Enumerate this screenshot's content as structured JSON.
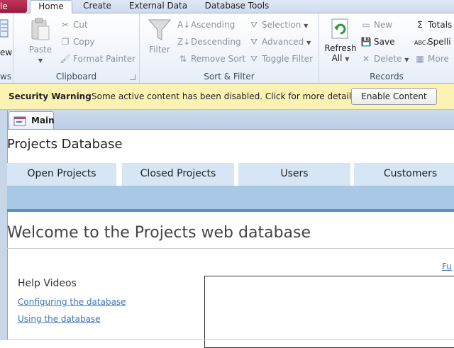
{
  "ribbon": {
    "file_tab": "le",
    "tabs": [
      "Home",
      "Create",
      "External Data",
      "Database Tools"
    ],
    "left_cut": {
      "view_label": "ew",
      "views_group": "ws"
    },
    "clipboard": {
      "label": "Clipboard",
      "paste": "Paste",
      "cut": "Cut",
      "copy": "Copy",
      "format_painter": "Format Painter"
    },
    "sort_filter": {
      "label": "Sort & Filter",
      "filter": "Filter",
      "ascending": "Ascending",
      "descending": "Descending",
      "remove_sort": "Remove Sort",
      "selection": "Selection",
      "advanced": "Advanced",
      "toggle_filter": "Toggle Filter"
    },
    "records": {
      "label": "Records",
      "refresh_all_line1": "Refresh",
      "refresh_all_line2": "All",
      "new": "New",
      "save": "Save",
      "delete": "Delete",
      "totals": "Totals",
      "spelling": "Spelli",
      "more": "More"
    }
  },
  "security_bar": {
    "title": "Security Warning",
    "message": "Some active content has been disabled. Click for more details.",
    "button": "Enable Content"
  },
  "document_tab": {
    "label": "Main"
  },
  "form": {
    "title": "Projects Database",
    "nav_tabs": [
      "Open Projects",
      "Closed Projects",
      "Users",
      "Customers"
    ],
    "welcome": "Welcome to the Projects web database",
    "corner_link": "Fu",
    "help": {
      "title": "Help Videos",
      "links": [
        "Configuring the database",
        "Using the database"
      ]
    }
  }
}
